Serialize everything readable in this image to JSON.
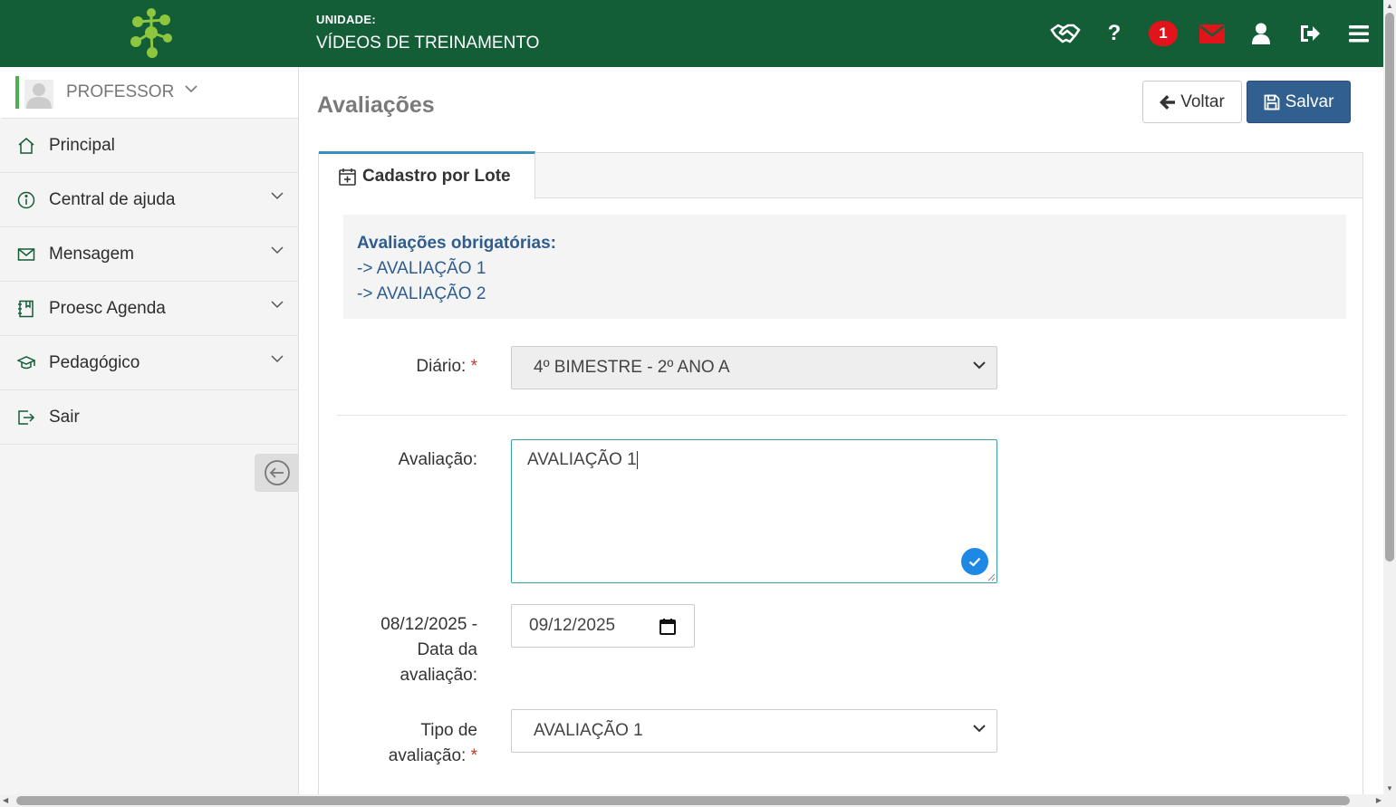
{
  "header": {
    "unit_label": "UNIDADE:",
    "unit_name": "VÍDEOS DE TREINAMENTO",
    "icons": [
      "handshake-icon",
      "help-icon",
      "notifications-badge",
      "mail-icon",
      "user-icon",
      "logout-icon",
      "hamburger-menu-icon"
    ],
    "notification_count": "1",
    "brand_color": "#135d37",
    "mail_color": "#e0141a"
  },
  "sidebar": {
    "profile_name": "PROFESSOR",
    "items": [
      {
        "label": "Principal",
        "icon": "home-icon",
        "expandable": false
      },
      {
        "label": "Central de ajuda",
        "icon": "info-icon",
        "expandable": true
      },
      {
        "label": "Mensagem",
        "icon": "envelope-icon",
        "expandable": true
      },
      {
        "label": "Proesc Agenda",
        "icon": "agenda-icon",
        "expandable": true
      },
      {
        "label": "Pedagógico",
        "icon": "graduation-cap-icon",
        "expandable": true
      },
      {
        "label": "Sair",
        "icon": "exit-icon",
        "expandable": false
      }
    ]
  },
  "main": {
    "page_title": "Avaliações",
    "back_label": "Voltar",
    "save_label": "Salvar",
    "tab_label": "Cadastro por Lote",
    "info": {
      "title": "Avaliações obrigatórias:",
      "lines": [
        "-> AVALIAÇÃO 1",
        "-> AVALIAÇÃO 2"
      ]
    },
    "form": {
      "diario_label": "Diário:",
      "diario_value": "4º BIMESTRE - 2º ANO A",
      "avaliacao_label": "Avaliação:",
      "avaliacao_value": "AVALIAÇÃO 1",
      "date_label_line1": "08/12/2025 -",
      "date_label_line2": "Data da",
      "date_label_line3": "avaliação:",
      "date_value": "09/12/2025",
      "tipo_label_line1": "Tipo de",
      "tipo_label_line2": "avaliação:",
      "tipo_value": "AVALIAÇÃO 1",
      "required_mark": "*"
    }
  }
}
